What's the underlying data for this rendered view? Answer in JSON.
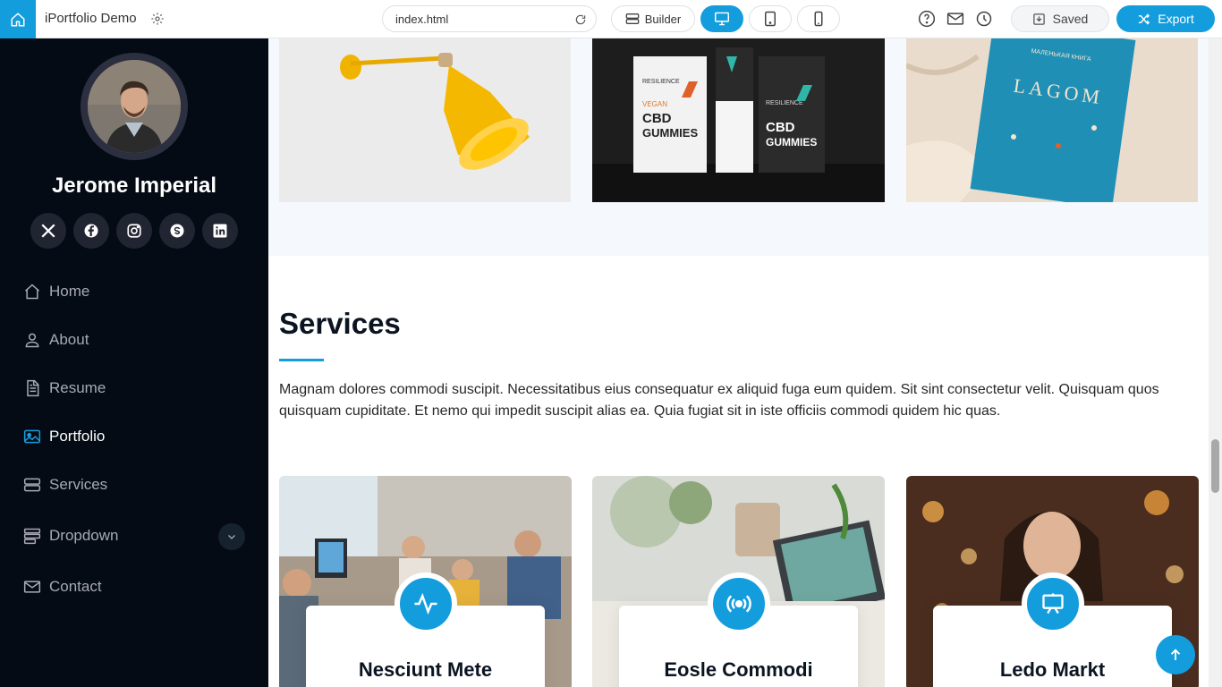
{
  "topbar": {
    "app_title": "iPortfolio Demo",
    "url": "index.html",
    "builder_label": "Builder",
    "saved_label": "Saved",
    "export_label": "Export"
  },
  "sidebar": {
    "profile_name": "Jerome Imperial",
    "social": [
      "x-icon",
      "facebook-icon",
      "instagram-icon",
      "skype-icon",
      "linkedin-icon"
    ],
    "nav": [
      {
        "label": "Home",
        "icon": "house-icon",
        "active": false
      },
      {
        "label": "About",
        "icon": "person-icon",
        "active": false
      },
      {
        "label": "Resume",
        "icon": "file-text-icon",
        "active": false
      },
      {
        "label": "Portfolio",
        "icon": "images-icon",
        "active": true
      },
      {
        "label": "Services",
        "icon": "hdd-stack-icon",
        "active": false
      },
      {
        "label": "Dropdown",
        "icon": "menu-icon",
        "active": false
      },
      {
        "label": "Contact",
        "icon": "envelope-icon",
        "active": false
      }
    ]
  },
  "services": {
    "title": "Services",
    "description": "Magnam dolores commodi suscipit. Necessitatibus eius consequatur ex aliquid fuga eum quidem. Sit sint consectetur velit. Quisquam quos quisquam cupiditate. Et nemo qui impedit suscipit alias ea. Quia fugiat sit in iste officiis commodi quidem hic quas.",
    "cards": [
      {
        "title": "Nesciunt Mete",
        "icon": "activity-icon"
      },
      {
        "title": "Eosle Commodi",
        "icon": "broadcast-icon"
      },
      {
        "title": "Ledo Markt",
        "icon": "easel-icon"
      }
    ]
  },
  "portfolio_images": {
    "lamp_label": "",
    "gummies_text": [
      "RESILIENCE",
      "VEGAN",
      "CBD",
      "GUMMIES"
    ],
    "book_text": [
      "МАЛЕНЬКАЯ КНИГА",
      "LAGOM"
    ]
  },
  "colors": {
    "accent": "#149ddd",
    "sidebar_bg": "#040b14",
    "portfolio_bg": "#f5f8fd"
  }
}
